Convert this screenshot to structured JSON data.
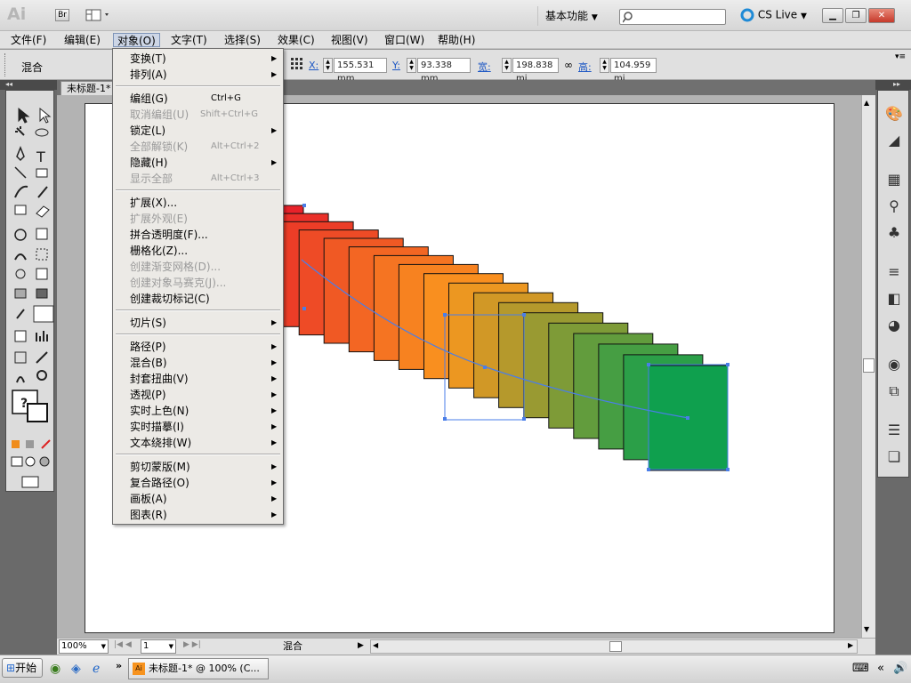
{
  "app": {
    "logo": "Ai",
    "bridge_label": "Br",
    "workspace": "基本功能",
    "cs_live": "CS Live"
  },
  "menubar": {
    "items": [
      "文件(F)",
      "编辑(E)",
      "对象(O)",
      "文字(T)",
      "选择(S)",
      "效果(C)",
      "视图(V)",
      "窗口(W)",
      "帮助(H)"
    ]
  },
  "control": {
    "object_type": "混合",
    "x_label": "X:",
    "x_value": "155.531 mm",
    "y_label": "Y:",
    "y_value": "93.338 mm",
    "w_label": "宽:",
    "w_value": "198.838 mi",
    "h_label": "高:",
    "h_value": "104.959 mi"
  },
  "document": {
    "tab_title": "未标题-1*"
  },
  "dropdown": {
    "groups": [
      [
        {
          "label": "变换(T)",
          "submenu": true
        },
        {
          "label": "排列(A)",
          "submenu": true
        }
      ],
      [
        {
          "label": "编组(G)",
          "shortcut": "Ctrl+G"
        },
        {
          "label": "取消编组(U)",
          "shortcut": "Shift+Ctrl+G",
          "disabled": true
        },
        {
          "label": "锁定(L)",
          "submenu": true
        },
        {
          "label": "全部解锁(K)",
          "shortcut": "Alt+Ctrl+2",
          "disabled": true
        },
        {
          "label": "隐藏(H)",
          "submenu": true
        },
        {
          "label": "显示全部",
          "shortcut": "Alt+Ctrl+3",
          "disabled": true
        }
      ],
      [
        {
          "label": "扩展(X)..."
        },
        {
          "label": "扩展外观(E)",
          "disabled": true
        },
        {
          "label": "拼合透明度(F)..."
        },
        {
          "label": "栅格化(Z)..."
        },
        {
          "label": "创建渐变网格(D)...",
          "disabled": true
        },
        {
          "label": "创建对象马赛克(J)...",
          "disabled": true
        },
        {
          "label": "创建裁切标记(C)"
        }
      ],
      [
        {
          "label": "切片(S)",
          "submenu": true
        }
      ],
      [
        {
          "label": "路径(P)",
          "submenu": true
        },
        {
          "label": "混合(B)",
          "submenu": true
        },
        {
          "label": "封套扭曲(V)",
          "submenu": true
        },
        {
          "label": "透视(P)",
          "submenu": true
        },
        {
          "label": "实时上色(N)",
          "submenu": true
        },
        {
          "label": "实时描摹(I)",
          "submenu": true
        },
        {
          "label": "文本绕排(W)",
          "submenu": true
        }
      ],
      [
        {
          "label": "剪切蒙版(M)",
          "submenu": true
        },
        {
          "label": "复合路径(O)",
          "submenu": true
        },
        {
          "label": "画板(A)",
          "submenu": true
        },
        {
          "label": "图表(R)",
          "submenu": true
        }
      ]
    ]
  },
  "status": {
    "zoom": "100%",
    "page": "1",
    "tool_state": "混合"
  },
  "taskbar": {
    "start": "开始",
    "task": "未标题-1* @ 100% (C..."
  },
  "colors": {
    "blend_start": "#e8222a",
    "blend_end": "#0fa04e",
    "selection": "#4a7ee8"
  }
}
